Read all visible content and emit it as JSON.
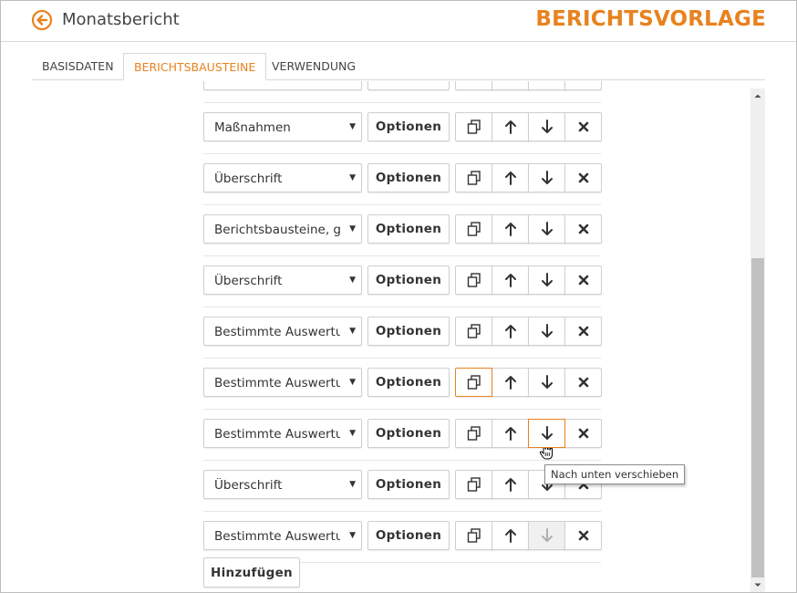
{
  "header": {
    "title": "Monatsbericht",
    "brand": "BERICHTSVORLAGE"
  },
  "tabs": [
    {
      "label": "BASISDATEN"
    },
    {
      "label": "BERICHTSBAUSTEINE",
      "active": true
    },
    {
      "label": "VERWENDUNG"
    }
  ],
  "rows": [
    {
      "select": "Maßnahmen",
      "options_label": "Optionen"
    },
    {
      "select": "Überschrift",
      "options_label": "Optionen"
    },
    {
      "select": "Berichtsbausteine, gruppiert",
      "options_label": "Optionen"
    },
    {
      "select": "Überschrift",
      "options_label": "Optionen"
    },
    {
      "select": "Bestimmte Auswertung",
      "options_label": "Optionen"
    },
    {
      "select": "Bestimmte Auswertung",
      "options_label": "Optionen"
    },
    {
      "select": "Bestimmte Auswertung",
      "options_label": "Optionen"
    },
    {
      "select": "Überschrift",
      "options_label": "Optionen"
    },
    {
      "select": "Bestimmte Auswertung",
      "options_label": "Optionen"
    }
  ],
  "icons": {
    "copy": "copy-icon",
    "up": "arrow-up-icon",
    "down": "arrow-down-icon",
    "delete": "close-icon"
  },
  "add_button": "Hinzufügen",
  "tooltip": "Nach unten verschieben",
  "colors": {
    "accent": "#e8821e"
  }
}
